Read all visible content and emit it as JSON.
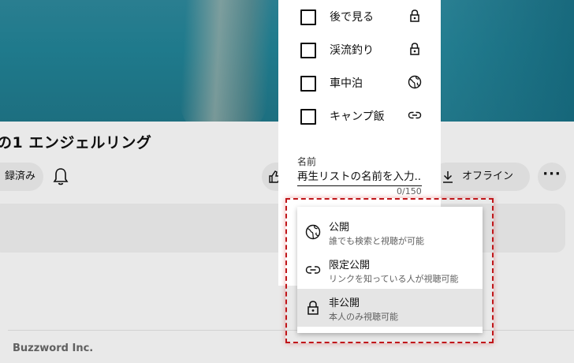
{
  "video": {
    "title": "の1 エンジェルリング",
    "subscribe_label": "録済み",
    "offline_label": "オフライン",
    "more_label": "···"
  },
  "footer": {
    "company": "Buzzword Inc."
  },
  "dialog": {
    "playlists": [
      {
        "label": "後で見る",
        "checked": false,
        "visibility_icon": "lock-icon"
      },
      {
        "label": "渓流釣り",
        "checked": false,
        "visibility_icon": "lock-icon"
      },
      {
        "label": "車中泊",
        "checked": false,
        "visibility_icon": "globe-icon"
      },
      {
        "label": "キャンプ飯",
        "checked": false,
        "visibility_icon": "link-icon"
      }
    ],
    "name_label": "名前",
    "name_placeholder": "再生リストの名前を入力...",
    "char_count": "0/150"
  },
  "privacy_menu": {
    "options": [
      {
        "label": "公開",
        "description": "誰でも検索と視聴が可能",
        "icon": "globe-icon",
        "selected": false
      },
      {
        "label": "限定公開",
        "description": "リンクを知っている人が視聴可能",
        "icon": "link-icon",
        "selected": false
      },
      {
        "label": "非公開",
        "description": "本人のみ視聴可能",
        "icon": "lock-icon",
        "selected": true
      }
    ]
  },
  "colors": {
    "highlight_border": "#c0161a",
    "selected_bg": "#e5e5e5",
    "page_bg": "#e9e9e9"
  }
}
